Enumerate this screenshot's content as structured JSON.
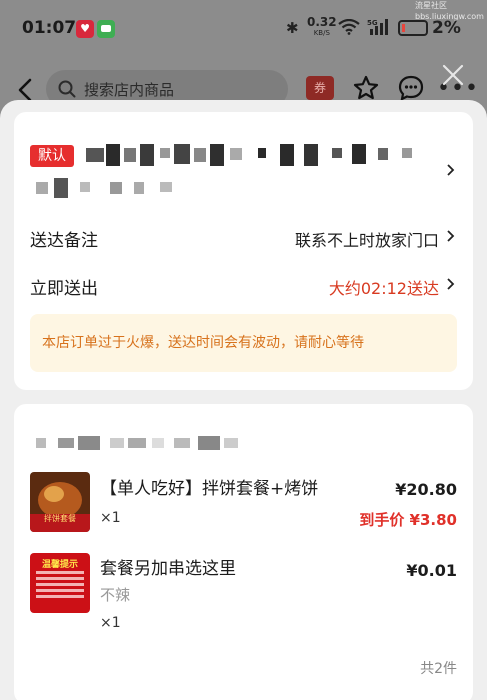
{
  "status_bar": {
    "time": "01:07",
    "net_speed": "0.32",
    "net_unit": "KB/S",
    "signal_type": "5G",
    "battery": "2%",
    "watermark": "流星社区 bbs.liuxingw.com"
  },
  "header": {
    "search_placeholder": "搜索店内商品",
    "coupon_label": "券"
  },
  "address": {
    "default_badge": "默认"
  },
  "delivery_note": {
    "label": "送达备注",
    "value": "联系不上时放家门口"
  },
  "delivery_time": {
    "label": "立即送出",
    "value": "大约02:12送达"
  },
  "notice": "本店订单过于火爆，送达时间会有波动，请耐心等待",
  "items": [
    {
      "name": "【单人吃好】拌饼套餐+烤饼",
      "qty": "×1",
      "price": "¥20.80",
      "final_price": "到手价 ¥3.80",
      "image_text": "拌饼套餐"
    },
    {
      "name": "套餐另加串选这里",
      "spec": "不辣",
      "qty": "×1",
      "price": "¥0.01",
      "image_text": "温馨提示"
    }
  ],
  "total_count": "共2件",
  "colors": {
    "accent_red": "#e62e2e",
    "price_red": "#e0312a",
    "notice_bg": "#fef6e3",
    "notice_text": "#d7721c"
  }
}
